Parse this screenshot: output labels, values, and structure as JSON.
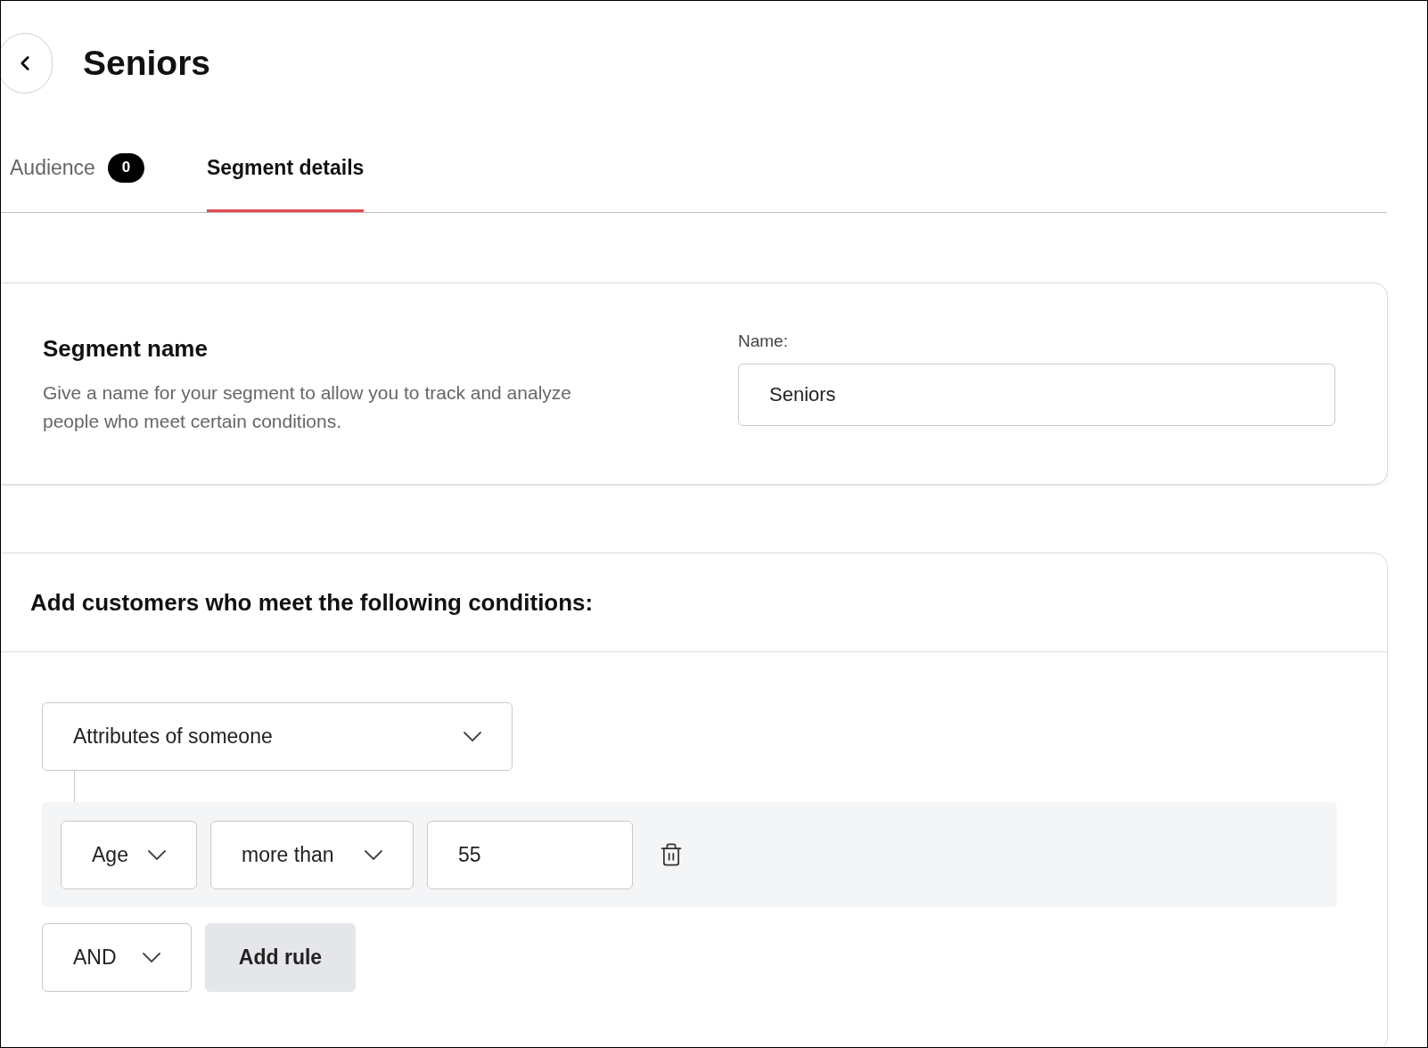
{
  "header": {
    "title": "Seniors"
  },
  "tabs": [
    {
      "label": "Audience",
      "badge": "0",
      "selected": false
    },
    {
      "label": "Segment details",
      "selected": true
    }
  ],
  "segment_name": {
    "title": "Segment name",
    "description": "Give a name for your segment to allow you to track and analyze people who meet certain conditions.",
    "field_label": "Name:",
    "value": "Seniors"
  },
  "conditions": {
    "title": "Add customers who meet the following conditions:",
    "group_select": "Attributes of someone",
    "rules": [
      {
        "attribute": "Age",
        "operator": "more than",
        "value": "55"
      }
    ],
    "combinator": "AND",
    "add_button": "Add rule"
  }
}
